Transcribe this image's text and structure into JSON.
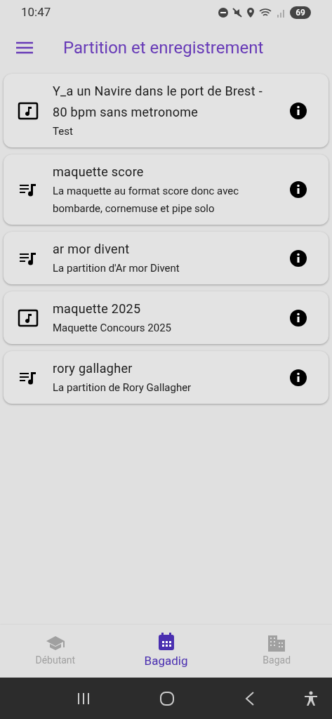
{
  "status_bar": {
    "time": "10:47",
    "battery": "69"
  },
  "app_bar": {
    "title": "Partition et enregistrement"
  },
  "items": [
    {
      "kind": "audio",
      "title": "Y_a un Navire dans le port de Brest - 80 bpm sans metronome",
      "subtitle": "Test"
    },
    {
      "kind": "score",
      "title": "maquette score",
      "subtitle": "La maquette au format score donc avec bombarde, cornemuse et pipe solo"
    },
    {
      "kind": "score",
      "title": "ar mor divent",
      "subtitle": "La partition d'Ar mor Divent"
    },
    {
      "kind": "audio",
      "title": "maquette 2025",
      "subtitle": "Maquette Concours 2025"
    },
    {
      "kind": "score",
      "title": "rory gallagher",
      "subtitle": "La partition de Rory Gallagher"
    }
  ],
  "bottom_nav": [
    {
      "kind": "school",
      "label": "Débutant",
      "selected": false
    },
    {
      "kind": "calendar",
      "label": "Bagadig",
      "selected": true
    },
    {
      "kind": "building",
      "label": "Bagad",
      "selected": false
    }
  ]
}
